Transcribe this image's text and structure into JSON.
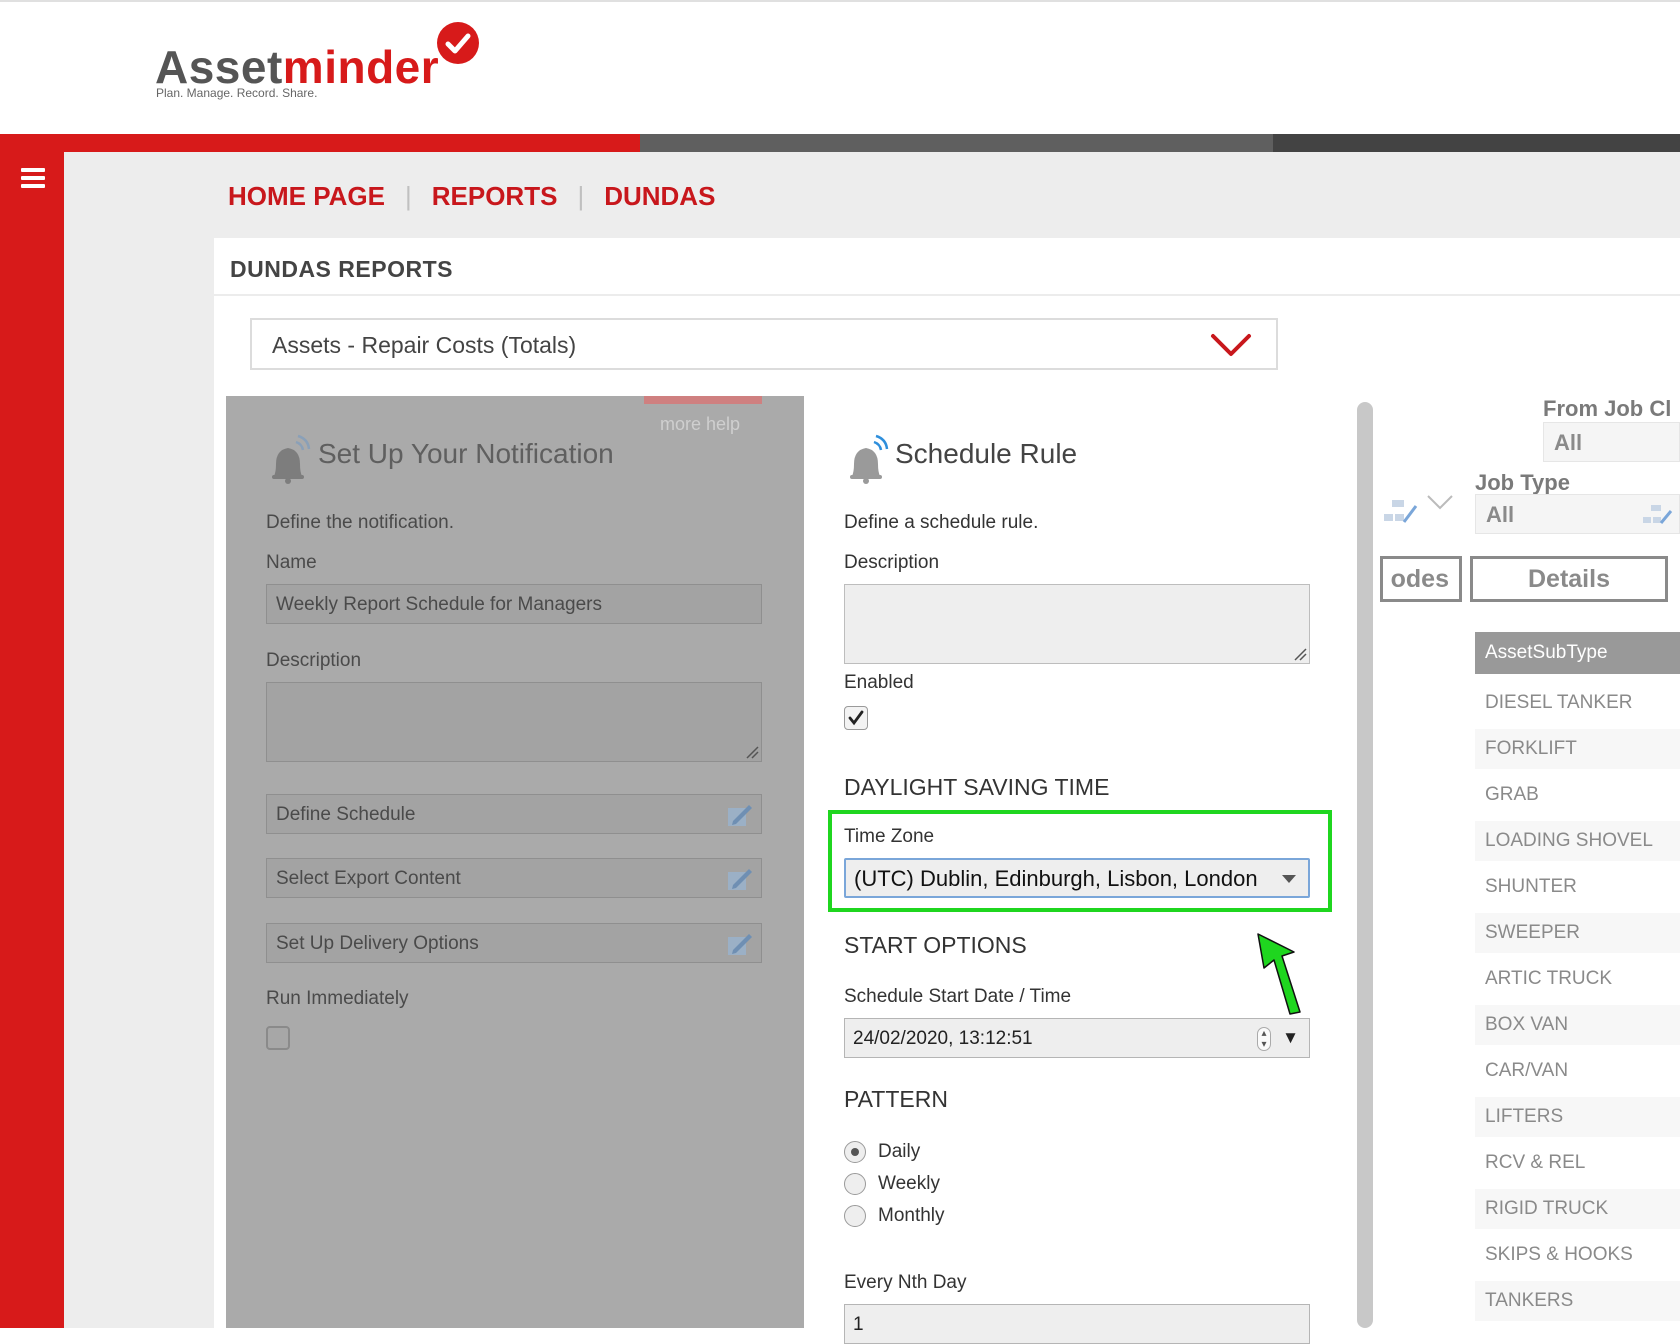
{
  "brand": {
    "name_part1": "Asset",
    "name_part2": "minder",
    "tagline": "Plan. Manage. Record. Share."
  },
  "colors": {
    "brand_red": "#d71a1a",
    "highlight_green": "#1fd61f"
  },
  "breadcrumb": [
    {
      "label": "HOME PAGE"
    },
    {
      "label": "REPORTS"
    },
    {
      "label": "DUNDAS"
    }
  ],
  "panel": {
    "title": "DUNDAS REPORTS"
  },
  "report_select": {
    "value": "Assets - Repair Costs (Totals)"
  },
  "notification": {
    "more_help": "more help",
    "title": "Set Up Your Notification",
    "intro": "Define the notification.",
    "name_label": "Name",
    "name_value": "Weekly Report Schedule for Managers",
    "description_label": "Description",
    "define_schedule": "Define Schedule",
    "select_export": "Select Export Content",
    "delivery_options": "Set Up Delivery Options",
    "run_immediately": "Run Immediately"
  },
  "schedule": {
    "title": "Schedule Rule",
    "intro": "Define a schedule rule.",
    "description_label": "Description",
    "enabled_label": "Enabled",
    "dst_heading": "DAYLIGHT SAVING TIME",
    "time_zone_label": "Time Zone",
    "time_zone_value": "(UTC) Dublin, Edinburgh, Lisbon, London",
    "start_heading": "START OPTIONS",
    "start_label": "Schedule Start Date / Time",
    "start_value": "24/02/2020, 13:12:51",
    "pattern_heading": "PATTERN",
    "patterns": [
      {
        "label": "Daily",
        "selected": true
      },
      {
        "label": "Weekly",
        "selected": false
      },
      {
        "label": "Monthly",
        "selected": false
      }
    ],
    "nth_label": "Every Nth Day",
    "nth_value": "1"
  },
  "report_bg": {
    "from_job_label": "From Job Cl",
    "from_job_value": "All",
    "job_type_label": "Job Type",
    "job_type_value": "All",
    "codes_tab": "odes",
    "details_tab": "Details",
    "list_header": "AssetSubType",
    "list_items": [
      "DIESEL TANKER",
      "FORKLIFT",
      "GRAB",
      "LOADING SHOVEL",
      "SHUNTER",
      "SWEEPER",
      "ARTIC TRUCK",
      "BOX VAN",
      "CAR/VAN",
      "LIFTERS",
      "RCV & REL",
      "RIGID TRUCK",
      "SKIPS & HOOKS",
      "TANKERS"
    ]
  }
}
